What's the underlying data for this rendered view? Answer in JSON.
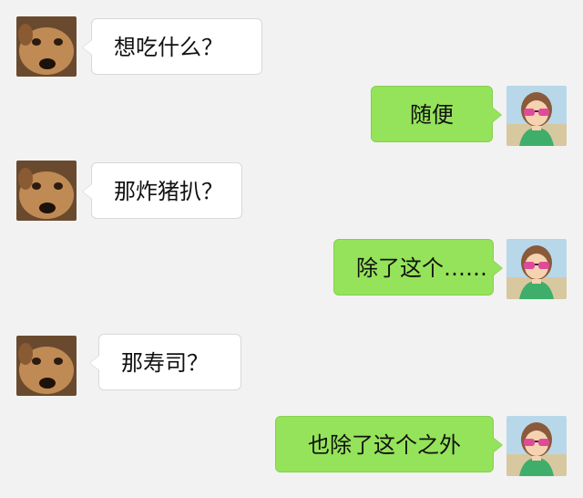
{
  "chat": {
    "messages": [
      {
        "side": "in",
        "sender": "dog",
        "text": "想吃什么？"
      },
      {
        "side": "out",
        "sender": "girl",
        "text": "随便"
      },
      {
        "side": "in",
        "sender": "dog",
        "text": "那炸猪扒？"
      },
      {
        "side": "out",
        "sender": "girl",
        "text": "除了这个……"
      },
      {
        "side": "in",
        "sender": "dog",
        "text": "那寿司？"
      },
      {
        "side": "out",
        "sender": "girl",
        "text": "也除了这个之外"
      }
    ]
  },
  "colors": {
    "background": "#f2f2f2",
    "incoming_bubble": "#ffffff",
    "outgoing_bubble": "#95e35a"
  },
  "icons": {
    "incoming_avatar": "dog-avatar-icon",
    "outgoing_avatar": "girl-sunglasses-avatar-icon"
  }
}
